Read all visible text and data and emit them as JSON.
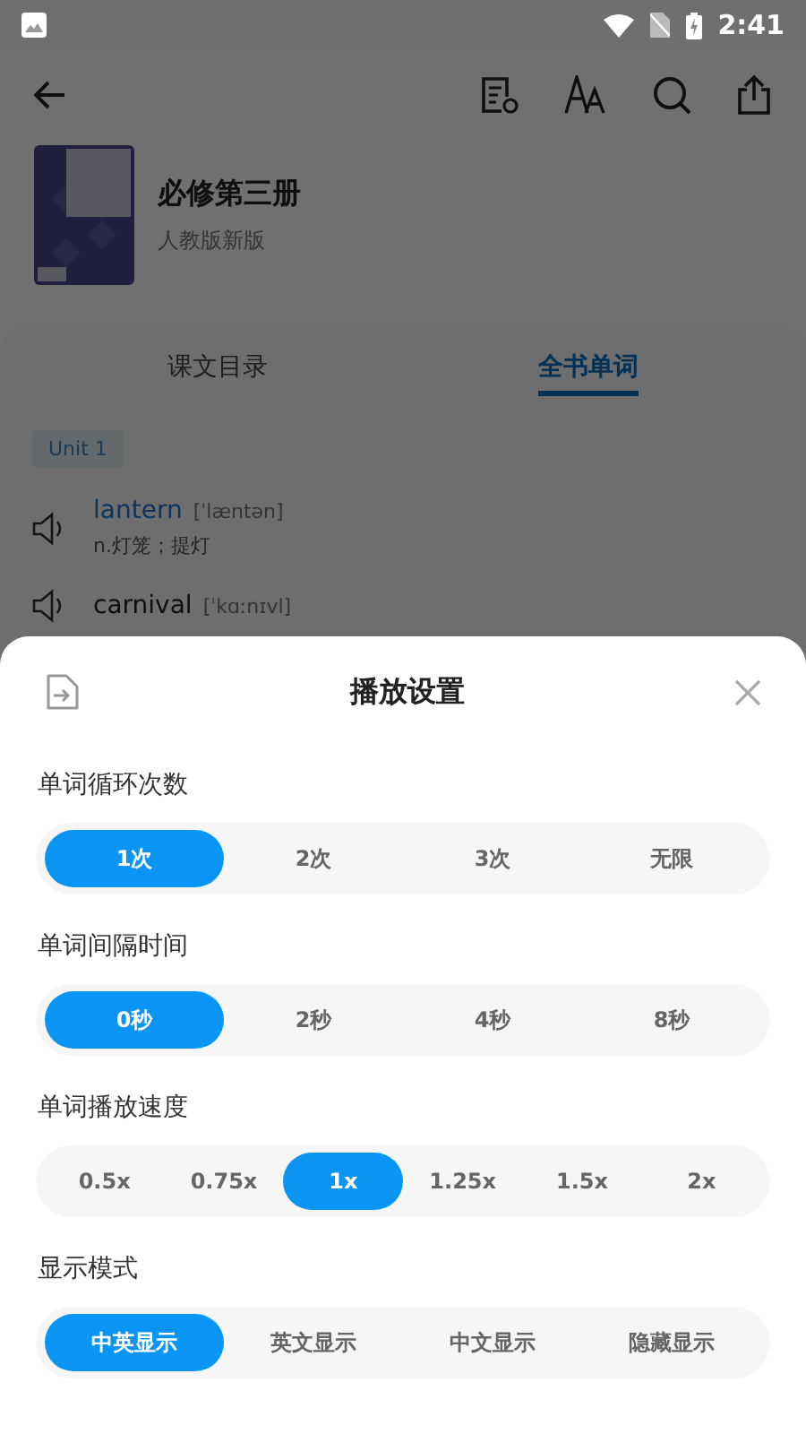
{
  "status_bar": {
    "time": "2:41"
  },
  "book": {
    "title": "必修第三册",
    "edition": "人教版新版"
  },
  "tabs": [
    {
      "label": "课文目录",
      "selected": false
    },
    {
      "label": "全书单词",
      "selected": true
    }
  ],
  "unit": "Unit 1",
  "words": [
    {
      "word": "lantern",
      "phonetic": "[ˈlæntən]",
      "meaning": "n.灯笼；提灯",
      "selected": true
    },
    {
      "word": "carnival",
      "phonetic": "[ˈkɑːnɪvl]",
      "selected": false
    }
  ],
  "sheet": {
    "title": "播放设置",
    "sections": [
      {
        "label": "单词循环次数",
        "options": [
          {
            "label": "1次",
            "selected": true
          },
          {
            "label": "2次",
            "selected": false
          },
          {
            "label": "3次",
            "selected": false
          },
          {
            "label": "无限",
            "selected": false
          }
        ]
      },
      {
        "label": "单词间隔时间",
        "options": [
          {
            "label": "0秒",
            "selected": true
          },
          {
            "label": "2秒",
            "selected": false
          },
          {
            "label": "4秒",
            "selected": false
          },
          {
            "label": "8秒",
            "selected": false
          }
        ]
      },
      {
        "label": "单词播放速度",
        "options": [
          {
            "label": "0.5x",
            "selected": false
          },
          {
            "label": "0.75x",
            "selected": false
          },
          {
            "label": "1x",
            "selected": true
          },
          {
            "label": "1.25x",
            "selected": false
          },
          {
            "label": "1.5x",
            "selected": false
          },
          {
            "label": "2x",
            "selected": false
          }
        ]
      },
      {
        "label": "显示模式",
        "options": [
          {
            "label": "中英显示",
            "selected": true
          },
          {
            "label": "英文显示",
            "selected": false
          },
          {
            "label": "中文显示",
            "selected": false
          },
          {
            "label": "隐藏显示",
            "selected": false
          }
        ]
      }
    ]
  }
}
